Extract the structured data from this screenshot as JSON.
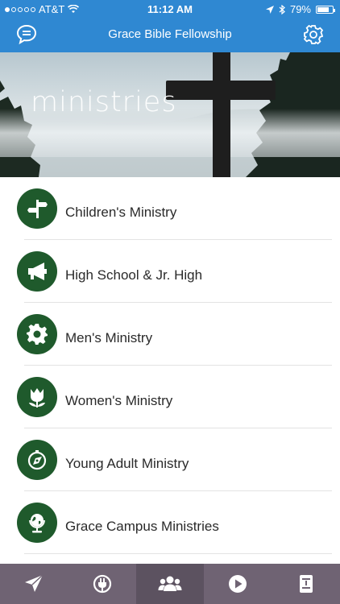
{
  "status_bar": {
    "carrier": "AT&T",
    "time": "11:12 AM",
    "battery": "79%",
    "battery_level": 0.79
  },
  "header": {
    "title": "Grace Bible Fellowship",
    "left_icon": "chat-bubble-icon",
    "right_icon": "gear-icon"
  },
  "banner": {
    "title": "ministries"
  },
  "ministries": [
    {
      "label": "Children's Ministry",
      "icon": "signpost-icon"
    },
    {
      "label": "High School & Jr. High",
      "icon": "megaphone-icon"
    },
    {
      "label": "Men's Ministry",
      "icon": "gear-icon"
    },
    {
      "label": "Women's Ministry",
      "icon": "tulip-icon"
    },
    {
      "label": "Young Adult Ministry",
      "icon": "compass-icon"
    },
    {
      "label": "Grace Campus Ministries",
      "icon": "globe-icon"
    }
  ],
  "tabs": [
    {
      "icon": "paper-plane-icon",
      "active": false
    },
    {
      "icon": "plug-icon",
      "active": false
    },
    {
      "icon": "people-icon",
      "active": true
    },
    {
      "icon": "play-icon",
      "active": false
    },
    {
      "icon": "book-icon",
      "active": false
    }
  ],
  "colors": {
    "header_bg": "#2f88d2",
    "icon_circle": "#1f5a2c",
    "tabbar_bg": "#6f6373"
  }
}
